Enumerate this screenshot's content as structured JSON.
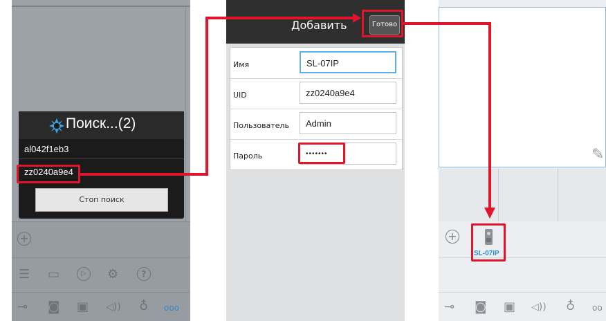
{
  "screen1": {
    "dialog_title": "Поиск...(2)",
    "devices": [
      "al042f1eb3",
      "zz0240a9e4"
    ],
    "stop_button": "Стоп поиск",
    "icons": [
      "add-circle-icon",
      "list-icon",
      "folder-icon",
      "play-icon",
      "settings-icon",
      "help-icon",
      "key-icon",
      "camera-icon",
      "video-icon",
      "speaker-icon",
      "mic-icon",
      "more-icon"
    ],
    "more_label": "ooo"
  },
  "screen2": {
    "header_title": "Добавить",
    "done_button": "Готово",
    "fields": [
      {
        "label": "Имя",
        "value": "SL-07IP"
      },
      {
        "label": "UID",
        "value": "zz0240a9e4"
      },
      {
        "label": "Пользователь",
        "value": "Admin"
      },
      {
        "label": "Пароль",
        "value": "•••••••"
      }
    ]
  },
  "screen3": {
    "device_name": "SL-07IP",
    "icons": [
      "add-circle-icon",
      "device-icon",
      "edit-icon",
      "key-icon",
      "camera-icon",
      "video-icon",
      "speaker-icon",
      "mic-icon",
      "more-icon"
    ],
    "more_label": "oo"
  },
  "colors": {
    "highlight": "#e0142a",
    "accent": "#2a8fd0",
    "active_field": "#5fb0e6"
  }
}
